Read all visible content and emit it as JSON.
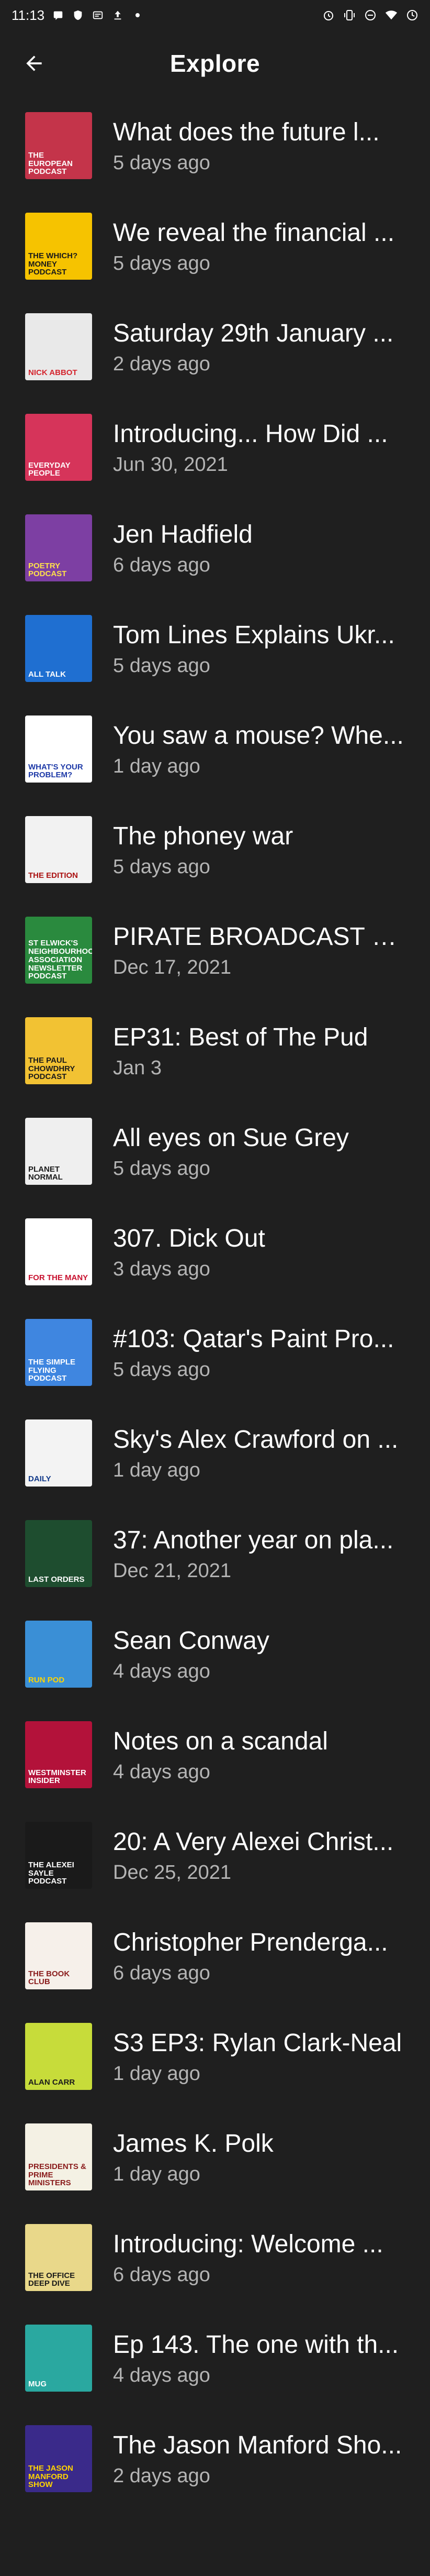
{
  "status_bar": {
    "time": "11:13",
    "left_icons": [
      "message-icon",
      "shield-icon",
      "cast-icon",
      "upload-icon",
      "dot-icon"
    ],
    "right_icons": [
      "alarm-icon",
      "vibrate-icon",
      "dnd-icon",
      "wifi-icon",
      "battery-icon"
    ]
  },
  "app_bar": {
    "title": "Explore",
    "back_icon": "arrow-back-icon"
  },
  "episodes": [
    {
      "title": "What does the future l...",
      "sub": "5 days ago",
      "thumb_bg": "#c4344a",
      "thumb_fg": "#ffffff",
      "thumb_text": "The European Podcast"
    },
    {
      "title": "We reveal the financial ...",
      "sub": "5 days ago",
      "thumb_bg": "#f6c300",
      "thumb_fg": "#1a1a1a",
      "thumb_text": "The Which? Money podcast"
    },
    {
      "title": "Saturday 29th January ...",
      "sub": "2 days ago",
      "thumb_bg": "#e9e9e9",
      "thumb_fg": "#d4252e",
      "thumb_text": "Nick Abbot"
    },
    {
      "title": "Introducing... How Did ...",
      "sub": "Jun 30, 2021",
      "thumb_bg": "#d6345a",
      "thumb_fg": "#ffffff",
      "thumb_text": "Everyday People"
    },
    {
      "title": "Jen Hadfield",
      "sub": "6 days ago",
      "thumb_bg": "#7d3fa3",
      "thumb_fg": "#ffe14a",
      "thumb_text": "Poetry Podcast"
    },
    {
      "title": "Tom Lines Explains Ukr...",
      "sub": "5 days ago",
      "thumb_bg": "#1f6fd1",
      "thumb_fg": "#ffffff",
      "thumb_text": "All Talk"
    },
    {
      "title": "You saw a mouse? Whe...",
      "sub": "1 day ago",
      "thumb_bg": "#ffffff",
      "thumb_fg": "#1e3aa8",
      "thumb_text": "What's your problem?"
    },
    {
      "title": "The phoney war",
      "sub": "5 days ago",
      "thumb_bg": "#f2f2f2",
      "thumb_fg": "#a11",
      "thumb_text": "The Edition"
    },
    {
      "title": "PIRATE BROADCAST E...",
      "sub": "Dec 17, 2021",
      "thumb_bg": "#2a8a3e",
      "thumb_fg": "#ffffff",
      "thumb_text": "St Elwick's Neighbourhood Association Newsletter Podcast"
    },
    {
      "title": "EP31: Best of The Pud",
      "sub": "Jan 3",
      "thumb_bg": "#f2c233",
      "thumb_fg": "#1a1a1a",
      "thumb_text": "The Paul Chowdhry Podcast"
    },
    {
      "title": "All eyes on Sue Grey",
      "sub": "5 days ago",
      "thumb_bg": "#efefef",
      "thumb_fg": "#1a1a1a",
      "thumb_text": "Planet Normal"
    },
    {
      "title": "307. Dick Out",
      "sub": "3 days ago",
      "thumb_bg": "#ffffff",
      "thumb_fg": "#c8102e",
      "thumb_text": "For the Many"
    },
    {
      "title": "#103: Qatar's Paint Pro...",
      "sub": "5 days ago",
      "thumb_bg": "#3f86e0",
      "thumb_fg": "#ffffff",
      "thumb_text": "The Simple Flying Podcast"
    },
    {
      "title": "Sky's Alex Crawford on ...",
      "sub": "1 day ago",
      "thumb_bg": "#f3f3f3",
      "thumb_fg": "#123a8a",
      "thumb_text": "Daily"
    },
    {
      "title": "37: Another year on pla...",
      "sub": "Dec 21, 2021",
      "thumb_bg": "#1e4d2f",
      "thumb_fg": "#ffffff",
      "thumb_text": "Last Orders"
    },
    {
      "title": "Sean Conway",
      "sub": "4 days ago",
      "thumb_bg": "#3a8fd6",
      "thumb_fg": "#ffd400",
      "thumb_text": "Run Pod"
    },
    {
      "title": "Notes on a scandal",
      "sub": "4 days ago",
      "thumb_bg": "#b3123a",
      "thumb_fg": "#ffffff",
      "thumb_text": "Westminster Insider"
    },
    {
      "title": "20: A Very Alexei Christ...",
      "sub": "Dec 25, 2021",
      "thumb_bg": "#1a1a1a",
      "thumb_fg": "#ffffff",
      "thumb_text": "The Alexei Sayle Podcast"
    },
    {
      "title": "Christopher Prenderga...",
      "sub": "6 days ago",
      "thumb_bg": "#f6f0ea",
      "thumb_fg": "#8a1c1c",
      "thumb_text": "The Book Club"
    },
    {
      "title": "S3 EP3: Rylan Clark-Neal",
      "sub": "1 day ago",
      "thumb_bg": "#c7dc3a",
      "thumb_fg": "#1a1a1a",
      "thumb_text": "Alan Carr"
    },
    {
      "title": "James K. Polk",
      "sub": "1 day ago",
      "thumb_bg": "#f4f1e4",
      "thumb_fg": "#8a1c1c",
      "thumb_text": "Presidents & Prime Ministers"
    },
    {
      "title": "Introducing: Welcome ...",
      "sub": "6 days ago",
      "thumb_bg": "#e9d88a",
      "thumb_fg": "#1a1a1a",
      "thumb_text": "The Office Deep Dive"
    },
    {
      "title": "Ep 143. The one with th...",
      "sub": "4 days ago",
      "thumb_bg": "#2aa8a0",
      "thumb_fg": "#ffffff",
      "thumb_text": "Mug"
    },
    {
      "title": "The Jason Manford Sho...",
      "sub": "2 days ago",
      "thumb_bg": "#3a2a8a",
      "thumb_fg": "#ffd400",
      "thumb_text": "The Jason Manford Show"
    }
  ]
}
